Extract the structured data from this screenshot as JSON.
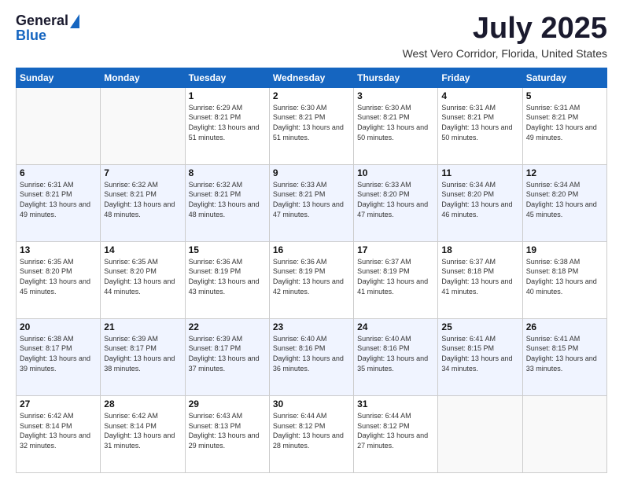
{
  "header": {
    "logo_line1": "General",
    "logo_line2": "Blue",
    "month": "July 2025",
    "location": "West Vero Corridor, Florida, United States"
  },
  "days_of_week": [
    "Sunday",
    "Monday",
    "Tuesday",
    "Wednesday",
    "Thursday",
    "Friday",
    "Saturday"
  ],
  "weeks": [
    [
      {
        "day": "",
        "sunrise": "",
        "sunset": "",
        "daylight": ""
      },
      {
        "day": "",
        "sunrise": "",
        "sunset": "",
        "daylight": ""
      },
      {
        "day": "1",
        "sunrise": "Sunrise: 6:29 AM",
        "sunset": "Sunset: 8:21 PM",
        "daylight": "Daylight: 13 hours and 51 minutes."
      },
      {
        "day": "2",
        "sunrise": "Sunrise: 6:30 AM",
        "sunset": "Sunset: 8:21 PM",
        "daylight": "Daylight: 13 hours and 51 minutes."
      },
      {
        "day": "3",
        "sunrise": "Sunrise: 6:30 AM",
        "sunset": "Sunset: 8:21 PM",
        "daylight": "Daylight: 13 hours and 50 minutes."
      },
      {
        "day": "4",
        "sunrise": "Sunrise: 6:31 AM",
        "sunset": "Sunset: 8:21 PM",
        "daylight": "Daylight: 13 hours and 50 minutes."
      },
      {
        "day": "5",
        "sunrise": "Sunrise: 6:31 AM",
        "sunset": "Sunset: 8:21 PM",
        "daylight": "Daylight: 13 hours and 49 minutes."
      }
    ],
    [
      {
        "day": "6",
        "sunrise": "Sunrise: 6:31 AM",
        "sunset": "Sunset: 8:21 PM",
        "daylight": "Daylight: 13 hours and 49 minutes."
      },
      {
        "day": "7",
        "sunrise": "Sunrise: 6:32 AM",
        "sunset": "Sunset: 8:21 PM",
        "daylight": "Daylight: 13 hours and 48 minutes."
      },
      {
        "day": "8",
        "sunrise": "Sunrise: 6:32 AM",
        "sunset": "Sunset: 8:21 PM",
        "daylight": "Daylight: 13 hours and 48 minutes."
      },
      {
        "day": "9",
        "sunrise": "Sunrise: 6:33 AM",
        "sunset": "Sunset: 8:21 PM",
        "daylight": "Daylight: 13 hours and 47 minutes."
      },
      {
        "day": "10",
        "sunrise": "Sunrise: 6:33 AM",
        "sunset": "Sunset: 8:20 PM",
        "daylight": "Daylight: 13 hours and 47 minutes."
      },
      {
        "day": "11",
        "sunrise": "Sunrise: 6:34 AM",
        "sunset": "Sunset: 8:20 PM",
        "daylight": "Daylight: 13 hours and 46 minutes."
      },
      {
        "day": "12",
        "sunrise": "Sunrise: 6:34 AM",
        "sunset": "Sunset: 8:20 PM",
        "daylight": "Daylight: 13 hours and 45 minutes."
      }
    ],
    [
      {
        "day": "13",
        "sunrise": "Sunrise: 6:35 AM",
        "sunset": "Sunset: 8:20 PM",
        "daylight": "Daylight: 13 hours and 45 minutes."
      },
      {
        "day": "14",
        "sunrise": "Sunrise: 6:35 AM",
        "sunset": "Sunset: 8:20 PM",
        "daylight": "Daylight: 13 hours and 44 minutes."
      },
      {
        "day": "15",
        "sunrise": "Sunrise: 6:36 AM",
        "sunset": "Sunset: 8:19 PM",
        "daylight": "Daylight: 13 hours and 43 minutes."
      },
      {
        "day": "16",
        "sunrise": "Sunrise: 6:36 AM",
        "sunset": "Sunset: 8:19 PM",
        "daylight": "Daylight: 13 hours and 42 minutes."
      },
      {
        "day": "17",
        "sunrise": "Sunrise: 6:37 AM",
        "sunset": "Sunset: 8:19 PM",
        "daylight": "Daylight: 13 hours and 41 minutes."
      },
      {
        "day": "18",
        "sunrise": "Sunrise: 6:37 AM",
        "sunset": "Sunset: 8:18 PM",
        "daylight": "Daylight: 13 hours and 41 minutes."
      },
      {
        "day": "19",
        "sunrise": "Sunrise: 6:38 AM",
        "sunset": "Sunset: 8:18 PM",
        "daylight": "Daylight: 13 hours and 40 minutes."
      }
    ],
    [
      {
        "day": "20",
        "sunrise": "Sunrise: 6:38 AM",
        "sunset": "Sunset: 8:17 PM",
        "daylight": "Daylight: 13 hours and 39 minutes."
      },
      {
        "day": "21",
        "sunrise": "Sunrise: 6:39 AM",
        "sunset": "Sunset: 8:17 PM",
        "daylight": "Daylight: 13 hours and 38 minutes."
      },
      {
        "day": "22",
        "sunrise": "Sunrise: 6:39 AM",
        "sunset": "Sunset: 8:17 PM",
        "daylight": "Daylight: 13 hours and 37 minutes."
      },
      {
        "day": "23",
        "sunrise": "Sunrise: 6:40 AM",
        "sunset": "Sunset: 8:16 PM",
        "daylight": "Daylight: 13 hours and 36 minutes."
      },
      {
        "day": "24",
        "sunrise": "Sunrise: 6:40 AM",
        "sunset": "Sunset: 8:16 PM",
        "daylight": "Daylight: 13 hours and 35 minutes."
      },
      {
        "day": "25",
        "sunrise": "Sunrise: 6:41 AM",
        "sunset": "Sunset: 8:15 PM",
        "daylight": "Daylight: 13 hours and 34 minutes."
      },
      {
        "day": "26",
        "sunrise": "Sunrise: 6:41 AM",
        "sunset": "Sunset: 8:15 PM",
        "daylight": "Daylight: 13 hours and 33 minutes."
      }
    ],
    [
      {
        "day": "27",
        "sunrise": "Sunrise: 6:42 AM",
        "sunset": "Sunset: 8:14 PM",
        "daylight": "Daylight: 13 hours and 32 minutes."
      },
      {
        "day": "28",
        "sunrise": "Sunrise: 6:42 AM",
        "sunset": "Sunset: 8:14 PM",
        "daylight": "Daylight: 13 hours and 31 minutes."
      },
      {
        "day": "29",
        "sunrise": "Sunrise: 6:43 AM",
        "sunset": "Sunset: 8:13 PM",
        "daylight": "Daylight: 13 hours and 29 minutes."
      },
      {
        "day": "30",
        "sunrise": "Sunrise: 6:44 AM",
        "sunset": "Sunset: 8:12 PM",
        "daylight": "Daylight: 13 hours and 28 minutes."
      },
      {
        "day": "31",
        "sunrise": "Sunrise: 6:44 AM",
        "sunset": "Sunset: 8:12 PM",
        "daylight": "Daylight: 13 hours and 27 minutes."
      },
      {
        "day": "",
        "sunrise": "",
        "sunset": "",
        "daylight": ""
      },
      {
        "day": "",
        "sunrise": "",
        "sunset": "",
        "daylight": ""
      }
    ]
  ]
}
